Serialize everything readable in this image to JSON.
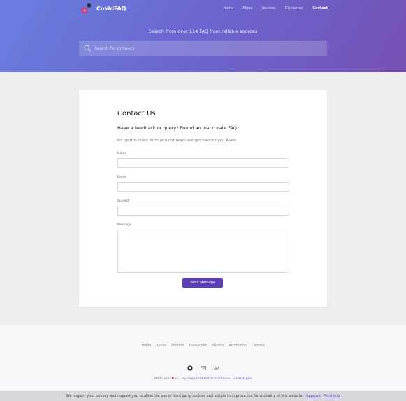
{
  "header": {
    "brand": "CovidFAQ",
    "nav": [
      "Home",
      "About",
      "Sources",
      "Disclaimer",
      "Contact"
    ],
    "active_nav": "Contact",
    "tagline": "Search from over 114 FAQ from reliable sources",
    "search": {
      "placeholder": "Search for answers",
      "value": ""
    }
  },
  "contact": {
    "title": "Contact Us",
    "subtitle": "Have a feedback or query? Found an inaccurate FAQ?",
    "description": "Fill up this quick form and our team will get back to you ASAP",
    "fields": {
      "name": {
        "label": "Name",
        "value": ""
      },
      "email": {
        "label": "Email",
        "value": ""
      },
      "subject": {
        "label": "Subject",
        "value": ""
      },
      "message": {
        "label": "Message",
        "value": ""
      }
    },
    "submit_label": "Send Message"
  },
  "footer": {
    "links": [
      "Home",
      "About",
      "Sources",
      "Disclaimer",
      "Privacy",
      "Attribution",
      "Contact"
    ],
    "icons": [
      "github-icon",
      "mail-icon",
      "link-icon"
    ],
    "made_prefix": "Made with",
    "made_and": "&",
    "made_by": "by",
    "authors": "Saiprasad Balasubramanian & Harsh Jain"
  },
  "cookie": {
    "text": "We respect your privacy and request you to allow the use of third party cookies and scripts to improve the functionality of this website.",
    "approve": "Approve",
    "more": "More info"
  },
  "colors": {
    "accent": "#5c3fb8",
    "hero_start": "#6a7ee0",
    "hero_end": "#7651b3"
  }
}
